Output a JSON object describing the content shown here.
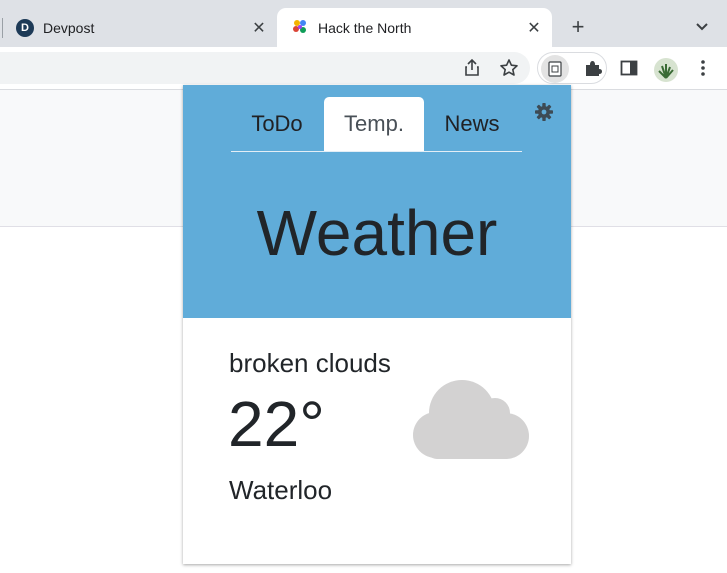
{
  "browser": {
    "tabs": [
      {
        "label": "Devpost",
        "favicon_letter": "D",
        "active": false
      },
      {
        "label": "Hack the North",
        "active": true
      }
    ],
    "new_tab_symbol": "+",
    "close_symbol": "✕"
  },
  "popup": {
    "nav_tabs": [
      {
        "label": "ToDo",
        "active": false
      },
      {
        "label": "Temp.",
        "active": true
      },
      {
        "label": "News",
        "active": false
      }
    ],
    "heading": "Weather",
    "weather": {
      "condition": "broken clouds",
      "temperature": "22°",
      "location": "Waterloo",
      "icon": "cloud-icon"
    },
    "colors": {
      "header_bg": "#60acd9",
      "cloud": "#d3d2d2"
    }
  }
}
